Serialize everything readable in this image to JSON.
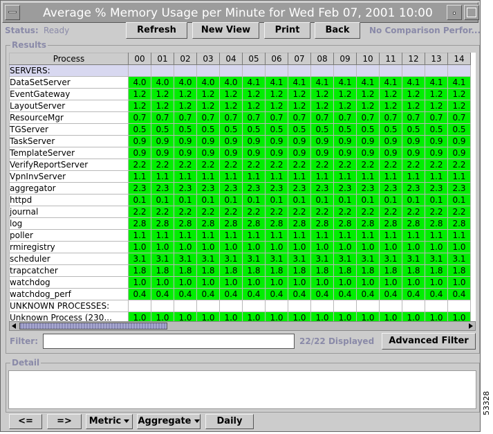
{
  "window": {
    "title": "Average % Memory Usage per Minute for Wed Feb 07, 2001 10:00"
  },
  "status": {
    "label": "Status:",
    "value": "Ready"
  },
  "toolbar": {
    "refresh_label": "Refresh",
    "new_view_label": "New View",
    "print_label": "Print",
    "back_label": "Back",
    "comparison_text": "No Comparison Perfor..."
  },
  "results": {
    "group_title": "Results",
    "process_header": "Process",
    "columns": [
      "00",
      "01",
      "02",
      "03",
      "04",
      "05",
      "06",
      "07",
      "08",
      "09",
      "10",
      "11",
      "12",
      "13",
      "14"
    ],
    "servers_label": "SERVERS:",
    "rows": [
      {
        "name": "DataSetServer",
        "values": [
          "4.0",
          "4.0",
          "4.0",
          "4.0",
          "4.0",
          "4.1",
          "4.1",
          "4.1",
          "4.1",
          "4.1",
          "4.1",
          "4.1",
          "4.1",
          "4.1",
          "4.1"
        ]
      },
      {
        "name": "EventGateway",
        "values": [
          "1.2",
          "1.2",
          "1.2",
          "1.2",
          "1.2",
          "1.2",
          "1.2",
          "1.2",
          "1.2",
          "1.2",
          "1.2",
          "1.2",
          "1.2",
          "1.2",
          "1.2"
        ]
      },
      {
        "name": "LayoutServer",
        "values": [
          "1.2",
          "1.2",
          "1.2",
          "1.2",
          "1.2",
          "1.2",
          "1.2",
          "1.2",
          "1.2",
          "1.2",
          "1.2",
          "1.2",
          "1.2",
          "1.2",
          "1.2"
        ]
      },
      {
        "name": "ResourceMgr",
        "values": [
          "0.7",
          "0.7",
          "0.7",
          "0.7",
          "0.7",
          "0.7",
          "0.7",
          "0.7",
          "0.7",
          "0.7",
          "0.7",
          "0.7",
          "0.7",
          "0.7",
          "0.7"
        ]
      },
      {
        "name": "TGServer",
        "values": [
          "0.5",
          "0.5",
          "0.5",
          "0.5",
          "0.5",
          "0.5",
          "0.5",
          "0.5",
          "0.5",
          "0.5",
          "0.5",
          "0.5",
          "0.5",
          "0.5",
          "0.5"
        ]
      },
      {
        "name": "TaskServer",
        "values": [
          "0.9",
          "0.9",
          "0.9",
          "0.9",
          "0.9",
          "0.9",
          "0.9",
          "0.9",
          "0.9",
          "0.9",
          "0.9",
          "0.9",
          "0.9",
          "0.9",
          "0.9"
        ]
      },
      {
        "name": "TemplateServer",
        "values": [
          "0.9",
          "0.9",
          "0.9",
          "0.9",
          "0.9",
          "0.9",
          "0.9",
          "0.9",
          "0.9",
          "0.9",
          "0.9",
          "0.9",
          "0.9",
          "0.9",
          "0.9"
        ]
      },
      {
        "name": "VerifyReportServer",
        "values": [
          "2.2",
          "2.2",
          "2.2",
          "2.2",
          "2.2",
          "2.2",
          "2.2",
          "2.2",
          "2.2",
          "2.2",
          "2.2",
          "2.2",
          "2.2",
          "2.2",
          "2.2"
        ]
      },
      {
        "name": "VpnInvServer",
        "values": [
          "1.1",
          "1.1",
          "1.1",
          "1.1",
          "1.1",
          "1.1",
          "1.1",
          "1.1",
          "1.1",
          "1.1",
          "1.1",
          "1.1",
          "1.1",
          "1.1",
          "1.1"
        ]
      },
      {
        "name": "aggregator",
        "values": [
          "2.3",
          "2.3",
          "2.3",
          "2.3",
          "2.3",
          "2.3",
          "2.3",
          "2.3",
          "2.3",
          "2.3",
          "2.3",
          "2.3",
          "2.3",
          "2.3",
          "2.3"
        ]
      },
      {
        "name": "httpd",
        "values": [
          "0.1",
          "0.1",
          "0.1",
          "0.1",
          "0.1",
          "0.1",
          "0.1",
          "0.1",
          "0.1",
          "0.1",
          "0.1",
          "0.1",
          "0.1",
          "0.1",
          "0.1"
        ]
      },
      {
        "name": "journal",
        "values": [
          "2.2",
          "2.2",
          "2.2",
          "2.2",
          "2.2",
          "2.2",
          "2.2",
          "2.2",
          "2.2",
          "2.2",
          "2.2",
          "2.2",
          "2.2",
          "2.2",
          "2.2"
        ]
      },
      {
        "name": "log",
        "values": [
          "2.8",
          "2.8",
          "2.8",
          "2.8",
          "2.8",
          "2.8",
          "2.8",
          "2.8",
          "2.8",
          "2.8",
          "2.8",
          "2.8",
          "2.8",
          "2.8",
          "2.8"
        ]
      },
      {
        "name": "poller",
        "values": [
          "1.1",
          "1.1",
          "1.1",
          "1.1",
          "1.1",
          "1.1",
          "1.1",
          "1.1",
          "1.1",
          "1.1",
          "1.1",
          "1.1",
          "1.1",
          "1.1",
          "1.1"
        ]
      },
      {
        "name": "rmiregistry",
        "values": [
          "1.0",
          "1.0",
          "1.0",
          "1.0",
          "1.0",
          "1.0",
          "1.0",
          "1.0",
          "1.0",
          "1.0",
          "1.0",
          "1.0",
          "1.0",
          "1.0",
          "1.0"
        ]
      },
      {
        "name": "scheduler",
        "values": [
          "3.1",
          "3.1",
          "3.1",
          "3.1",
          "3.1",
          "3.1",
          "3.1",
          "3.1",
          "3.1",
          "3.1",
          "3.1",
          "3.1",
          "3.1",
          "3.1",
          "3.1"
        ]
      },
      {
        "name": "trapcatcher",
        "values": [
          "1.8",
          "1.8",
          "1.8",
          "1.8",
          "1.8",
          "1.8",
          "1.8",
          "1.8",
          "1.8",
          "1.8",
          "1.8",
          "1.8",
          "1.8",
          "1.8",
          "1.8"
        ]
      },
      {
        "name": "watchdog",
        "values": [
          "1.0",
          "1.0",
          "1.0",
          "1.0",
          "1.0",
          "1.0",
          "1.0",
          "1.0",
          "1.0",
          "1.0",
          "1.0",
          "1.0",
          "1.0",
          "1.0",
          "1.0"
        ]
      },
      {
        "name": "watchdog_perf",
        "values": [
          "0.4",
          "0.4",
          "0.4",
          "0.4",
          "0.4",
          "0.4",
          "0.4",
          "0.4",
          "0.4",
          "0.4",
          "0.4",
          "0.4",
          "0.4",
          "0.4",
          "0.4"
        ]
      }
    ],
    "unknown_label": "UNKNOWN PROCESSES:",
    "unknown_rows": [
      {
        "name": "Unknown Process (230...",
        "values": [
          "1.0",
          "1.0",
          "1.0",
          "1.0",
          "1.0",
          "1.0",
          "1.0",
          "1.0",
          "1.0",
          "1.0",
          "1.0",
          "1.0",
          "1.0",
          "1.0",
          "1.0"
        ]
      }
    ],
    "cell_color": "#00ee00",
    "servers_row_color": "#d8d8f0"
  },
  "filter": {
    "label": "Filter:",
    "value": "",
    "displayed": "22/22 Displayed",
    "advanced_label": "Advanced Filter"
  },
  "detail": {
    "group_title": "Detail"
  },
  "bottom_bar": {
    "prev_label": "<=",
    "next_label": "=>",
    "metric_label": "Metric",
    "aggregate_label": "Aggregate",
    "daily_label": "Daily"
  },
  "figure_id": "53328"
}
